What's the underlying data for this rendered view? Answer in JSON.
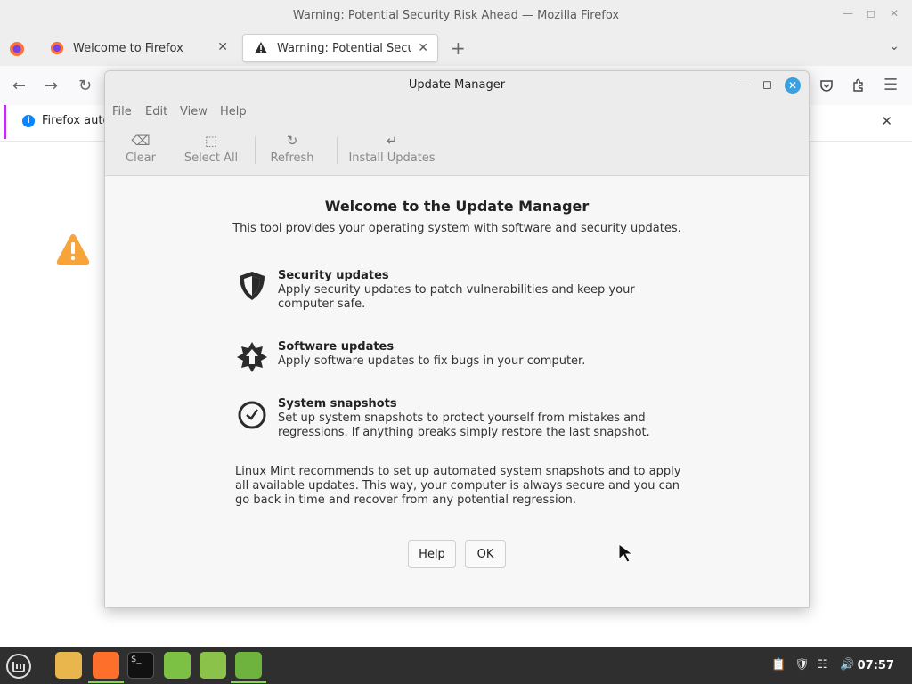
{
  "firefox": {
    "window_title": "Warning: Potential Security Risk Ahead — Mozilla Firefox",
    "tabs": [
      {
        "label": "Welcome to Firefox",
        "active": false
      },
      {
        "label": "Warning: Potential Security Risk Ahead",
        "active": true
      }
    ],
    "new_tab_symbol": "+",
    "notification_text": "Firefox auto",
    "accent_color": "#b833e1"
  },
  "update_manager": {
    "title": "Update Manager",
    "menu": [
      "File",
      "Edit",
      "View",
      "Help"
    ],
    "toolbar": {
      "clear": "Clear",
      "select_all": "Select All",
      "refresh": "Refresh",
      "install_updates": "Install Updates"
    },
    "welcome": {
      "heading": "Welcome to the Update Manager",
      "subtitle": "This tool provides your operating system with software and security updates."
    },
    "features": [
      {
        "icon": "shield-icon",
        "title": "Security updates",
        "description": "Apply security updates to patch vulnerabilities and keep your computer safe."
      },
      {
        "icon": "star-arrow-icon",
        "title": "Software updates",
        "description": "Apply software updates to fix bugs in your computer."
      },
      {
        "icon": "clock-icon",
        "title": "System snapshots",
        "description": "Set up system snapshots to protect yourself from mistakes and regressions. If anything breaks simply restore the last snapshot."
      }
    ],
    "recommendation": "Linux Mint recommends to set up automated system snapshots and to apply all available updates. This way, your computer is always secure and you can go back in time and recover from any potential regression.",
    "buttons": {
      "help": "Help",
      "ok": "OK"
    },
    "close_color": "#3aa0e0"
  },
  "taskbar": {
    "clock": "07:57",
    "apps": [
      "menu-icon",
      "files-icon",
      "firefox-icon",
      "terminal-icon",
      "mintinstall-icon",
      "spreadsheet-icon",
      "update-manager-icon"
    ]
  }
}
